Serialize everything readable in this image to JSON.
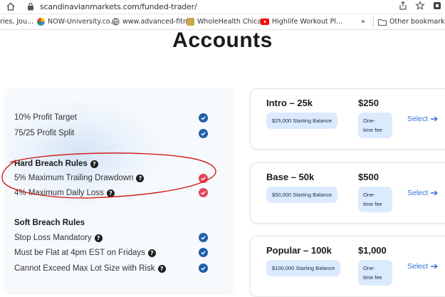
{
  "browser": {
    "url": "scandinavianmarkets.com/funded-trader/",
    "bookmarks": [
      {
        "label": "ries, Jou...",
        "icon": "none"
      },
      {
        "label": "NOW-University.co...",
        "icon": "now-university-icon"
      },
      {
        "label": "www.advanced-fitn...",
        "icon": "globe-icon"
      },
      {
        "label": "WholeHealth Chica...",
        "icon": "wholehealth-icon"
      },
      {
        "label": "Highlife Workout Pl...",
        "icon": "youtube-icon"
      }
    ],
    "overflow_label": "»",
    "other_bookmarks_label": "Other bookmarks"
  },
  "page": {
    "title": "Accounts"
  },
  "features": {
    "general": [
      {
        "label": "10% Profit Target",
        "status": "blue"
      },
      {
        "label": "75/25 Profit Split",
        "status": "blue"
      }
    ],
    "hard_breach": {
      "heading": "Hard Breach Rules",
      "items": [
        {
          "label": "5% Maximum Trailing Drawdown",
          "status": "red"
        },
        {
          "label": "4% Maximum Daily Loss",
          "status": "red"
        }
      ]
    },
    "soft_breach": {
      "heading": "Soft Breach Rules",
      "items": [
        {
          "label": "Stop Loss Mandatory",
          "status": "blue"
        },
        {
          "label": "Must be Flat at 4pm EST on Fridays",
          "status": "blue"
        },
        {
          "label": "Cannot Exceed Max Lot Size with Risk",
          "status": "blue"
        }
      ]
    }
  },
  "plans": [
    {
      "name": "Intro – 25k",
      "balance": "$25,000 Starting Balance",
      "price": "$250",
      "fee_line1": "One-",
      "fee_line2": "time fee",
      "select": "Select"
    },
    {
      "name": "Base – 50k",
      "balance": "$50,000 Starting Balance",
      "price": "$500",
      "fee_line1": "One-",
      "fee_line2": "time fee",
      "select": "Select"
    },
    {
      "name": "Popular – 100k",
      "balance": "$100,000 Starting Balance",
      "price": "$1,000",
      "fee_line1": "One-",
      "fee_line2": "time fee",
      "select": "Select"
    }
  ],
  "colors": {
    "check_blue": "#1f5fa8",
    "check_red": "#e0475b",
    "accent_link": "#2f6fd6",
    "pill_bg": "#dbeafc",
    "annotation_red": "#d21f1f"
  }
}
